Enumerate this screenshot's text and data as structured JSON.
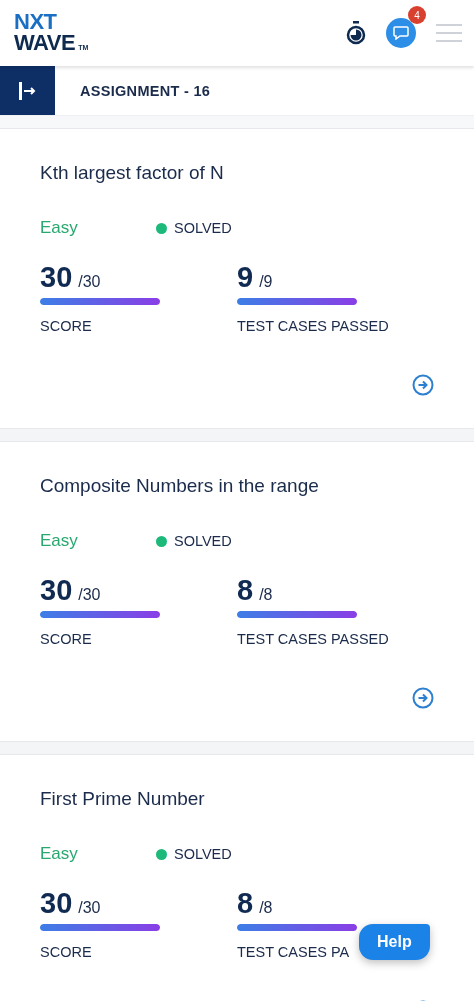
{
  "header": {
    "logo_top": "NXT",
    "logo_bottom": "WAVE",
    "logo_mark": "TM",
    "notification_count": "4"
  },
  "assignment_bar": {
    "title": "ASSIGNMENT - 16"
  },
  "problems": [
    {
      "title": "Kth largest factor of N",
      "difficulty": "Easy",
      "status": "SOLVED",
      "color": "#1db97a",
      "score": "30",
      "score_total": "/30",
      "score_bar": {
        "level": 1
      },
      "score_label": "SCORE",
      "tests": "9",
      "tests_total": "/9",
      "tests_bar": {
        "level": 1
      },
      "tests_label": "TEST CASES PASSED"
    },
    {
      "title": "Composite Numbers in the range",
      "difficulty": "Easy",
      "status": "SOLVED",
      "color": "#1db97a",
      "score": "30",
      "score_total": "/30",
      "score_bar": {
        "level": 1
      },
      "score_label": "SCORE",
      "tests": "8",
      "tests_total": "/8",
      "tests_bar": {
        "level": 1
      },
      "tests_label": "TEST CASES PASSED"
    },
    {
      "title": "First Prime Number",
      "difficulty": "Easy",
      "status": "SOLVED",
      "color": "#1db97a",
      "score": "30",
      "score_total": "/30",
      "score_bar": {
        "level": 1
      },
      "score_label": "SCORE",
      "tests": "8",
      "tests_total": "/8",
      "tests_bar": {
        "level": 1
      },
      "tests_label": "TEST CASES PA"
    }
  ],
  "help_button": {
    "label": "Help"
  }
}
